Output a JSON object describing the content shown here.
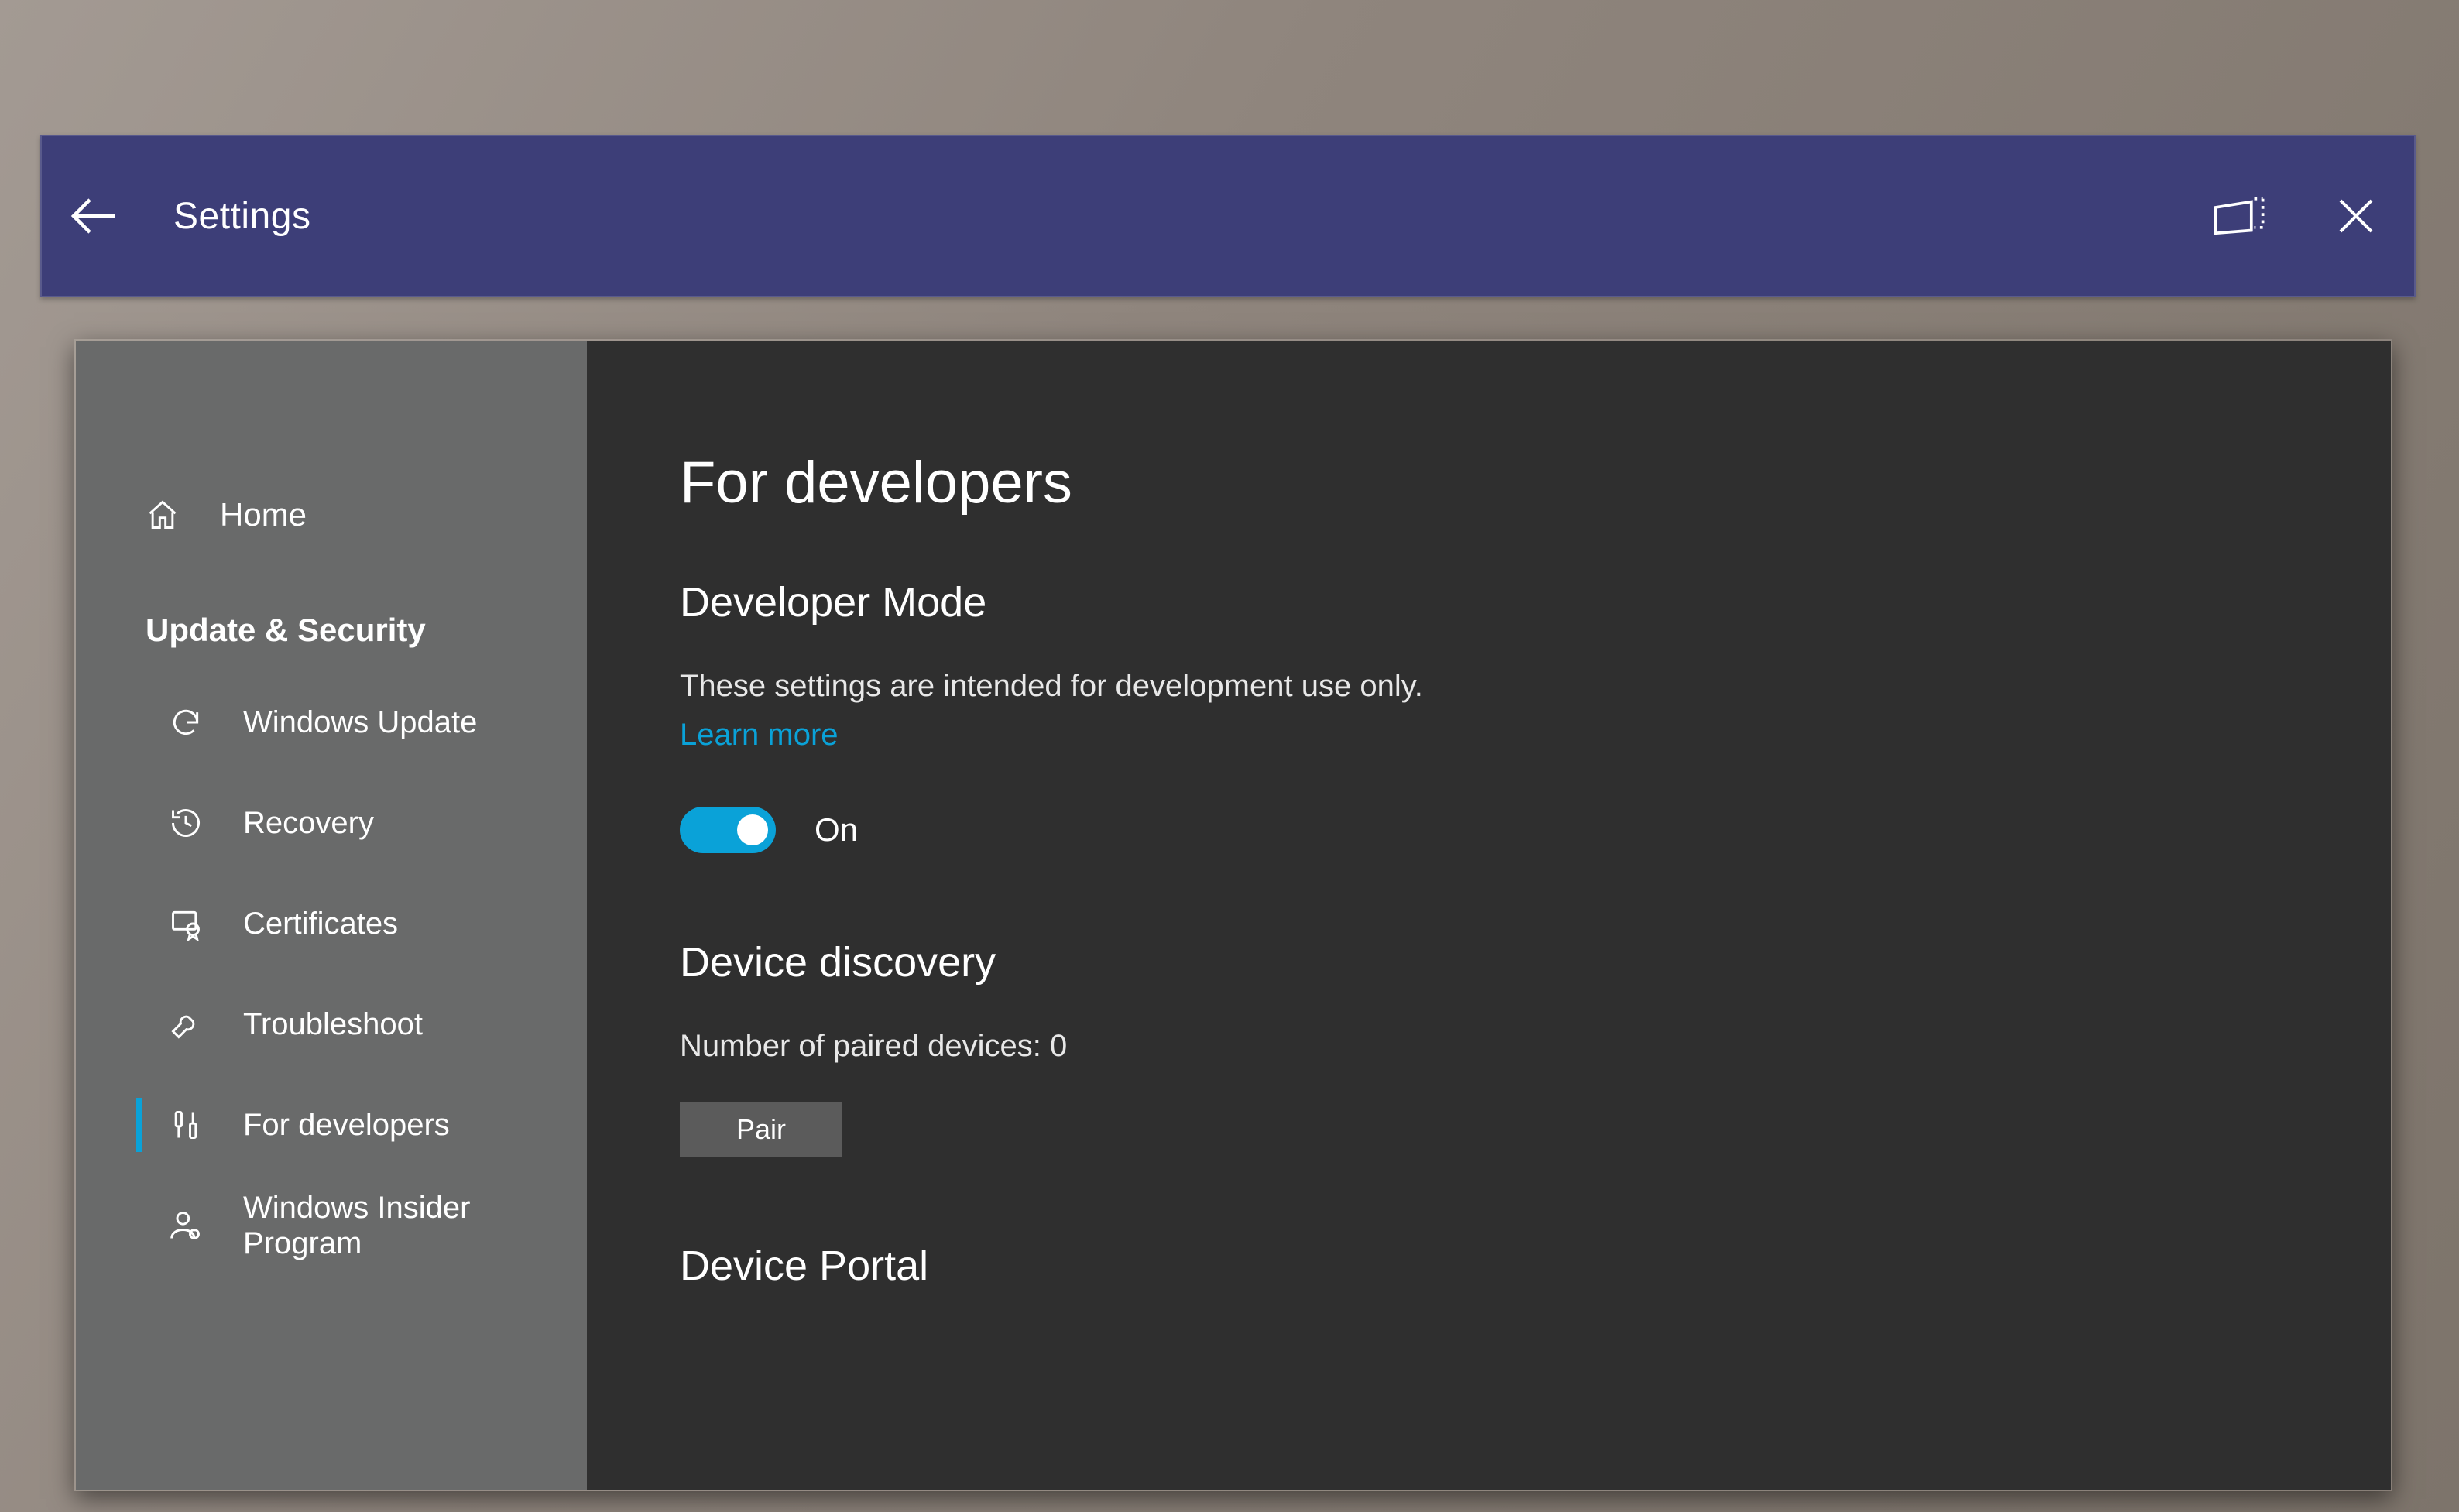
{
  "titlebar": {
    "title": "Settings"
  },
  "sidebar": {
    "home": "Home",
    "category": "Update & Security",
    "items": [
      {
        "icon": "sync",
        "label": "Windows Update"
      },
      {
        "icon": "history",
        "label": "Recovery"
      },
      {
        "icon": "cert",
        "label": "Certificates"
      },
      {
        "icon": "wrench",
        "label": "Troubleshoot"
      },
      {
        "icon": "dev",
        "label": "For developers",
        "active": true
      },
      {
        "icon": "insider",
        "label": "Windows Insider\nProgram"
      }
    ]
  },
  "content": {
    "page_title": "For developers",
    "dev_mode": {
      "heading": "Developer Mode",
      "desc": "These settings are intended for development use only.",
      "learn_more": "Learn more",
      "toggle_state": "On"
    },
    "discovery": {
      "heading": "Device discovery",
      "paired": "Number of paired devices: 0",
      "pair_button": "Pair"
    },
    "portal": {
      "heading": "Device Portal"
    }
  }
}
